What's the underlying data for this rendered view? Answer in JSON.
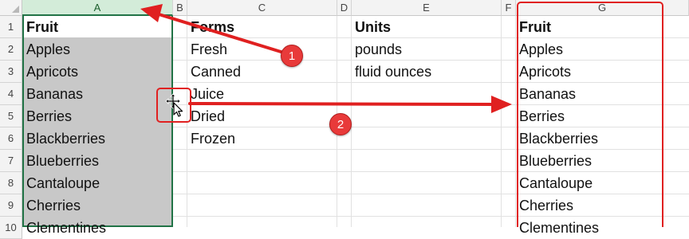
{
  "columns": [
    "A",
    "B",
    "C",
    "D",
    "E",
    "F",
    "G"
  ],
  "rows": [
    "1",
    "2",
    "3",
    "4",
    "5",
    "6",
    "7",
    "8",
    "9",
    "10"
  ],
  "column_a": [
    "Fruit",
    "Apples",
    "Apricots",
    "Bananas",
    "Berries",
    "Blackberries",
    "Blueberries",
    "Cantaloupe",
    "Cherries",
    "Clementines"
  ],
  "column_c": [
    "Forms",
    "Fresh",
    "Canned",
    "Juice",
    "Dried",
    "Frozen"
  ],
  "column_e": [
    "Units",
    "pounds",
    "fluid ounces"
  ],
  "column_g": [
    "Fruit",
    "Apples",
    "Apricots",
    "Bananas",
    "Berries",
    "Blackberries",
    "Blueberries",
    "Cantaloupe",
    "Cherries",
    "Clementines"
  ],
  "annotations": {
    "step1_label": "1",
    "step2_label": "2",
    "color": "#e02020"
  },
  "selection": {
    "column": "A",
    "accent": "#217346"
  },
  "icons": {
    "cursor": "move-cursor-icon"
  }
}
